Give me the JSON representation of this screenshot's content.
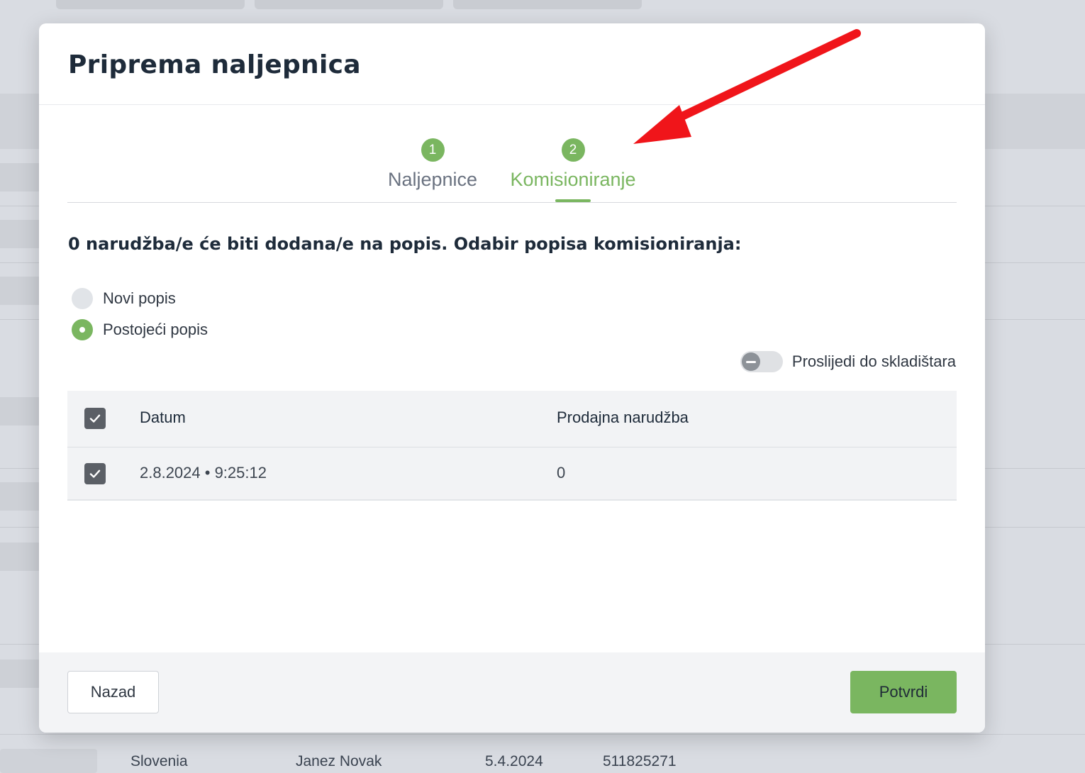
{
  "modal": {
    "title": "Priprema naljepnica",
    "steps": [
      {
        "number": "1",
        "label": "Naljepnice",
        "state": "inactive"
      },
      {
        "number": "2",
        "label": "Komisioniranje",
        "state": "active"
      }
    ],
    "info_text": "0 narudžba/e će biti dodana/e na popis. Odabir popisa komisioniranja:",
    "radio_options": [
      {
        "label": "Novi popis",
        "selected": false
      },
      {
        "label": "Postojeći popis",
        "selected": true
      }
    ],
    "toggle": {
      "label": "Proslijedi do skladištara",
      "on": false
    },
    "table": {
      "headers": {
        "date": "Datum",
        "order": "Prodajna narudžba"
      },
      "header_checked": true,
      "rows": [
        {
          "checked": true,
          "date": "2.8.2024 • 9:25:12",
          "order": "0"
        }
      ]
    },
    "footer": {
      "back_label": "Nazad",
      "confirm_label": "Potvrdi"
    }
  },
  "background_row": {
    "country": "Slovenia",
    "name": "Janez Novak",
    "date": "5.4.2024",
    "number": "511825271"
  },
  "colors": {
    "accent": "#7ab660",
    "annotation_arrow": "#f0151a",
    "checkbox": "#5b5f66"
  },
  "icons": [
    "check-icon",
    "toggle-minus-icon",
    "annotation-arrow"
  ]
}
